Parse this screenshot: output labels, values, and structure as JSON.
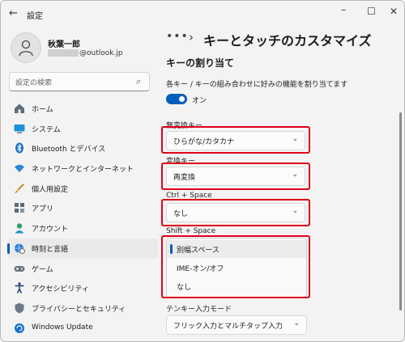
{
  "window": {
    "title": "設定"
  },
  "user": {
    "name": "秋葉一郎",
    "email_domain": "@outlook.jp"
  },
  "search": {
    "placeholder": "設定の検索"
  },
  "nav": [
    {
      "label": "ホーム",
      "icon": "home-icon"
    },
    {
      "label": "システム",
      "icon": "system-display-icon"
    },
    {
      "label": "Bluetooth とデバイス",
      "icon": "bluetooth-icon"
    },
    {
      "label": "ネットワークとインターネット",
      "icon": "wifi-icon"
    },
    {
      "label": "個人用設定",
      "icon": "paintbrush-icon"
    },
    {
      "label": "アプリ",
      "icon": "apps-icon"
    },
    {
      "label": "アカウント",
      "icon": "account-icon"
    },
    {
      "label": "時刻と言語",
      "icon": "globe-clock-icon",
      "selected": true
    },
    {
      "label": "ゲーム",
      "icon": "gamepad-icon"
    },
    {
      "label": "アクセシビリティ",
      "icon": "accessibility-icon"
    },
    {
      "label": "プライバシーとセキュリティ",
      "icon": "shield-icon"
    },
    {
      "label": "Windows Update",
      "icon": "update-icon"
    }
  ],
  "breadcrumb": {
    "ellipsis": "•••",
    "separator": "›",
    "title": "キーとタッチのカスタマイズ"
  },
  "section": {
    "title": "キーの割り当て",
    "description": "各キー / キーの組み合わせに好みの機能を割り当てます",
    "toggle_label": "オン",
    "toggle_on": true
  },
  "fields": [
    {
      "label": "無変換キー",
      "value": "ひらがな/カタカナ"
    },
    {
      "label": "変換キー",
      "value": "再変換"
    },
    {
      "label": "Ctrl + Space",
      "value": "なし"
    },
    {
      "label": "Shift + Space",
      "open": true,
      "options": [
        "別幅スペース",
        "IME-オン/オフ",
        "なし"
      ],
      "selected_index": 0
    },
    {
      "label": "テンキー入力モード",
      "value": "フリック入力とマルチタップ入力"
    }
  ],
  "colors": {
    "accent": "#005fb8",
    "highlight": "#e0001b",
    "background": "#f3f3f3"
  }
}
